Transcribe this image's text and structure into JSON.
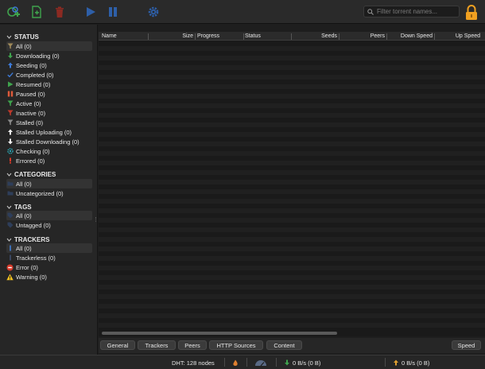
{
  "toolbar": {
    "buttons": [
      "add-torrent-link",
      "add-torrent-file",
      "delete",
      "resume",
      "pause",
      "options"
    ],
    "search_placeholder": "Filter torrent names..."
  },
  "sidebar": {
    "status": {
      "title": "STATUS",
      "items": [
        {
          "label": "All (0)",
          "icon": "filter-icon"
        },
        {
          "label": "Downloading (0)",
          "icon": "download-arrow-icon"
        },
        {
          "label": "Seeding (0)",
          "icon": "upload-arrow-icon"
        },
        {
          "label": "Completed (0)",
          "icon": "checkmark-icon"
        },
        {
          "label": "Resumed (0)",
          "icon": "play-icon"
        },
        {
          "label": "Paused (0)",
          "icon": "pause-icon"
        },
        {
          "label": "Active (0)",
          "icon": "active-filter-icon"
        },
        {
          "label": "Inactive (0)",
          "icon": "inactive-filter-icon"
        },
        {
          "label": "Stalled (0)",
          "icon": "stalled-filter-icon"
        },
        {
          "label": "Stalled Uploading (0)",
          "icon": "stalled-up-icon"
        },
        {
          "label": "Stalled Downloading (0)",
          "icon": "stalled-down-icon"
        },
        {
          "label": "Checking (0)",
          "icon": "checking-icon"
        },
        {
          "label": "Errored (0)",
          "icon": "error-icon"
        }
      ]
    },
    "categories": {
      "title": "CATEGORIES",
      "items": [
        {
          "label": "All (0)",
          "icon": "folder-icon"
        },
        {
          "label": "Uncategorized (0)",
          "icon": "folder-icon"
        }
      ]
    },
    "tags": {
      "title": "TAGS",
      "items": [
        {
          "label": "All (0)",
          "icon": "tag-icon"
        },
        {
          "label": "Untagged (0)",
          "icon": "tag-icon"
        }
      ]
    },
    "trackers": {
      "title": "TRACKERS",
      "items": [
        {
          "label": "All (0)",
          "icon": "tracker-icon"
        },
        {
          "label": "Trackerless (0)",
          "icon": "trackerless-icon"
        },
        {
          "label": "Error (0)",
          "icon": "error-circle-icon"
        },
        {
          "label": "Warning (0)",
          "icon": "warning-icon"
        }
      ]
    }
  },
  "table": {
    "columns": [
      "Name",
      "Size",
      "Progress",
      "Status",
      "Seeds",
      "Peers",
      "Down Speed",
      "Up Speed"
    ]
  },
  "tabs": [
    "General",
    "Trackers",
    "Peers",
    "HTTP Sources",
    "Content"
  ],
  "speed_button": "Speed",
  "statusbar": {
    "dht": "DHT: 128 nodes",
    "download": "0 B/s (0 B)",
    "upload": "0 B/s (0 B)"
  },
  "colors": {
    "accent_green": "#3fa34d",
    "accent_blue": "#3d7bd9",
    "accent_red": "#c0392b",
    "lock_orange": "#f0a020"
  }
}
